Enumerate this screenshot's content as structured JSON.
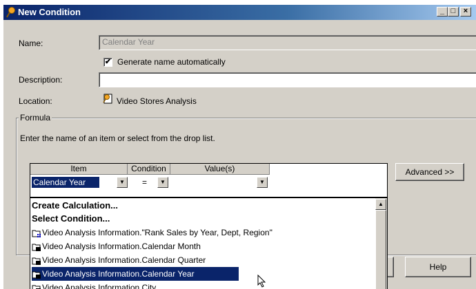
{
  "window": {
    "title": "New Condition"
  },
  "titlebar_buttons": {
    "minimize": "_",
    "maximize": "□",
    "close": "×"
  },
  "form": {
    "name_label": "Name:",
    "name_value": "Calendar Year",
    "generate_checkbox_label": "Generate name automatically",
    "generate_checked": "✔",
    "description_label": "Description:",
    "description_value": "",
    "location_label": "Location:",
    "location_value": "Video Stores Analysis"
  },
  "formula": {
    "legend": "Formula",
    "instructions": "Enter the name of an item or select from the drop list.",
    "columns": [
      "Item",
      "Condition",
      "Value(s)"
    ],
    "row": {
      "item": "Calendar Year",
      "condition": "=",
      "value": ""
    },
    "advanced_button": "Advanced >>"
  },
  "dropdown": {
    "items": [
      {
        "label": "Create Calculation...",
        "bold": true
      },
      {
        "label": "Select Condition...",
        "bold": true
      },
      {
        "label": "Video Analysis Information.\"Rank Sales by Year, Dept, Region\"",
        "icon": "calc-folder-icon"
      },
      {
        "label": "Video Analysis Information.Calendar Month",
        "icon": "item-folder-icon"
      },
      {
        "label": "Video Analysis Information.Calendar Quarter",
        "icon": "item-folder-icon"
      },
      {
        "label": "Video Analysis Information.Calendar Year",
        "icon": "item-folder-icon",
        "selected": true
      },
      {
        "label": "Video Analysis Information.City",
        "icon": "item-folder-icon"
      }
    ]
  },
  "buttons": {
    "help": "Help"
  },
  "colors": {
    "selection": "#0a246a",
    "dialog_bg": "#d4d0c8",
    "title_gradient_start": "#0a246a"
  }
}
